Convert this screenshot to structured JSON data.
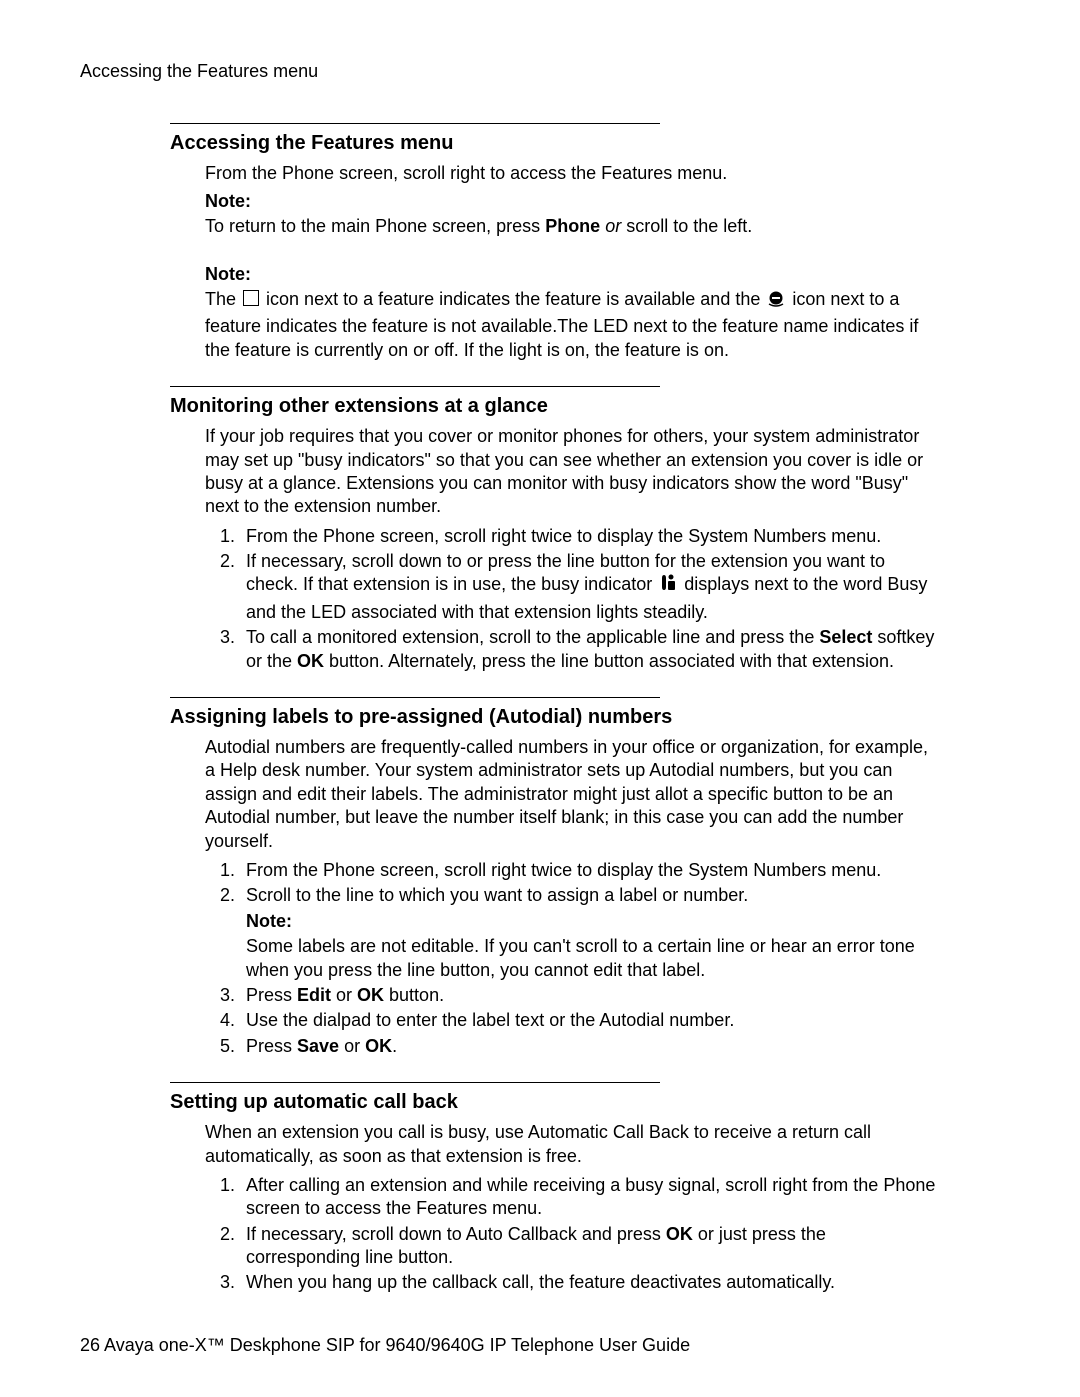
{
  "labels": {
    "note": "Note:"
  },
  "runningHeader": "Accessing the Features menu",
  "footer": "26 Avaya one-X™ Deskphone SIP for 9640/9640G IP Telephone User Guide",
  "section1": {
    "heading": "Accessing the Features menu",
    "p1": "From the Phone screen, scroll right to access the Features menu.",
    "note1_a": "To return to the main Phone screen, press ",
    "note1_b_bold": "Phone",
    "note1_c": " ",
    "note1_d_italic": "or",
    "note1_e": " scroll to the left.",
    "note2_a": "The ",
    "note2_b": " icon next to a feature indicates the feature is available and the ",
    "note2_c": " icon next to a feature indicates the feature is not available.The LED next to the feature name indicates if the feature is currently on or off. If the light is on, the feature is on."
  },
  "section2": {
    "heading": "Monitoring other extensions at a glance",
    "intro": "If your job requires that you cover or monitor phones for others, your system administrator may set up \"busy indicators\" so that you can see whether an extension you cover is idle or busy at a glance. Extensions you can monitor with busy indicators show the word \"Busy\" next to the extension number.",
    "li1": "From the Phone screen, scroll right twice to display the System Numbers menu.",
    "li2_a": "If necessary, scroll down to or press the line button for the extension you want to check. If that extension is in use, the busy indicator ",
    "li2_b": " displays next to the word Busy and the LED associated with that extension lights steadily.",
    "li3_a": "To call a monitored extension, scroll to the applicable line and press the ",
    "li3_b_bold": "Select",
    "li3_c": " softkey or the ",
    "li3_d_bold": "OK",
    "li3_e": " button. Alternately, press the line button associated with that extension."
  },
  "section3": {
    "heading": "Assigning labels to pre-assigned (Autodial) numbers",
    "intro": "Autodial numbers are frequently-called numbers in your office or organization, for example, a Help desk number. Your system administrator sets up Autodial numbers, but you can assign and edit their labels. The administrator might just allot a specific button to be an Autodial number, but leave the number itself blank; in this case you can add the number yourself.",
    "li1": "From the Phone screen, scroll right twice to display the System Numbers menu.",
    "li2": "Scroll to the line to which you want to assign a label or number.",
    "li2_note": "Some labels are not editable. If you can't scroll to a certain line or hear an error tone when you press the line button, you cannot edit that label.",
    "li3_a": "Press ",
    "li3_b_bold": "Edit",
    "li3_c": " or ",
    "li3_d_bold": "OK",
    "li3_e": " button.",
    "li4": "Use the dialpad to enter the label text or the Autodial number.",
    "li5_a": "Press ",
    "li5_b_bold": "Save",
    "li5_c": " or ",
    "li5_d_bold": "OK",
    "li5_e": "."
  },
  "section4": {
    "heading": "Setting up automatic call back",
    "intro": "When an extension you call is busy, use Automatic Call Back to receive a return call automatically, as soon as that extension is free.",
    "li1": "After calling an extension and while receiving a busy signal, scroll right from the Phone screen to access the Features menu.",
    "li2_a": "If necessary, scroll down to Auto Callback and press ",
    "li2_b_bold": "OK",
    "li2_c": " or just press the corresponding line button.",
    "li3": "When you hang up the callback call, the feature deactivates automatically."
  }
}
